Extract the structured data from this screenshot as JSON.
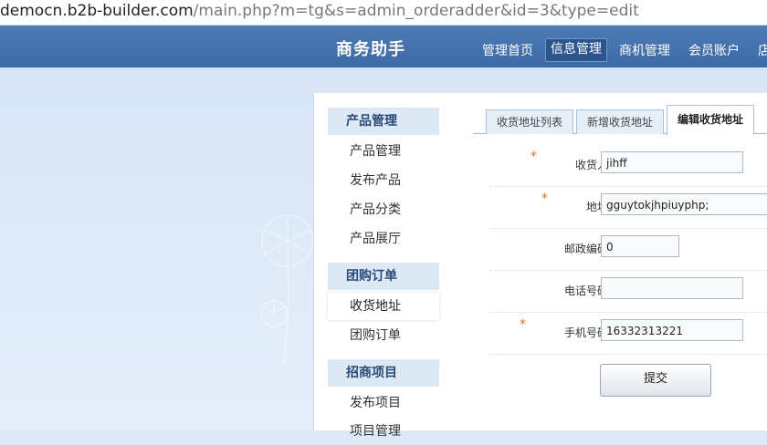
{
  "browser": {
    "url_host": "democn.b2b-builder.com",
    "url_path": "/main.php?m=tg&s=admin_orderadder&id=3&type=edit"
  },
  "topnav": {
    "brand": "商务助手",
    "items": [
      {
        "label": "管理首页"
      },
      {
        "label": "信息管理",
        "active": true
      },
      {
        "label": "商机管理"
      },
      {
        "label": "会员账户"
      },
      {
        "label": "店"
      }
    ]
  },
  "sidebar": {
    "sections": [
      {
        "title": "产品管理",
        "items": [
          "产品管理",
          "发布产品",
          "产品分类",
          "产品展厅"
        ]
      },
      {
        "title": "团购订单",
        "items": [
          "收货地址",
          "团购订单"
        ]
      },
      {
        "title": "招商项目",
        "items": [
          "发布项目",
          "项目管理"
        ]
      }
    ]
  },
  "tabs": [
    {
      "label": "收货地址列表"
    },
    {
      "label": "新增收货地址"
    },
    {
      "label": "编辑收货地址",
      "active": true
    }
  ],
  "form": {
    "consignee": {
      "label": "收货人:",
      "value": "jihff",
      "required": true
    },
    "address": {
      "label": "地址:",
      "value": "gguytokjhpiuyphp;",
      "required": true
    },
    "postcode": {
      "label": "邮政编码:",
      "value": "0",
      "required": false
    },
    "phone": {
      "label": "电话号码:",
      "value": "",
      "required": false
    },
    "mobile": {
      "label": "手机号码:",
      "value": "16332313221",
      "required": true
    },
    "required_mark": "*",
    "submit_label": "提交"
  }
}
